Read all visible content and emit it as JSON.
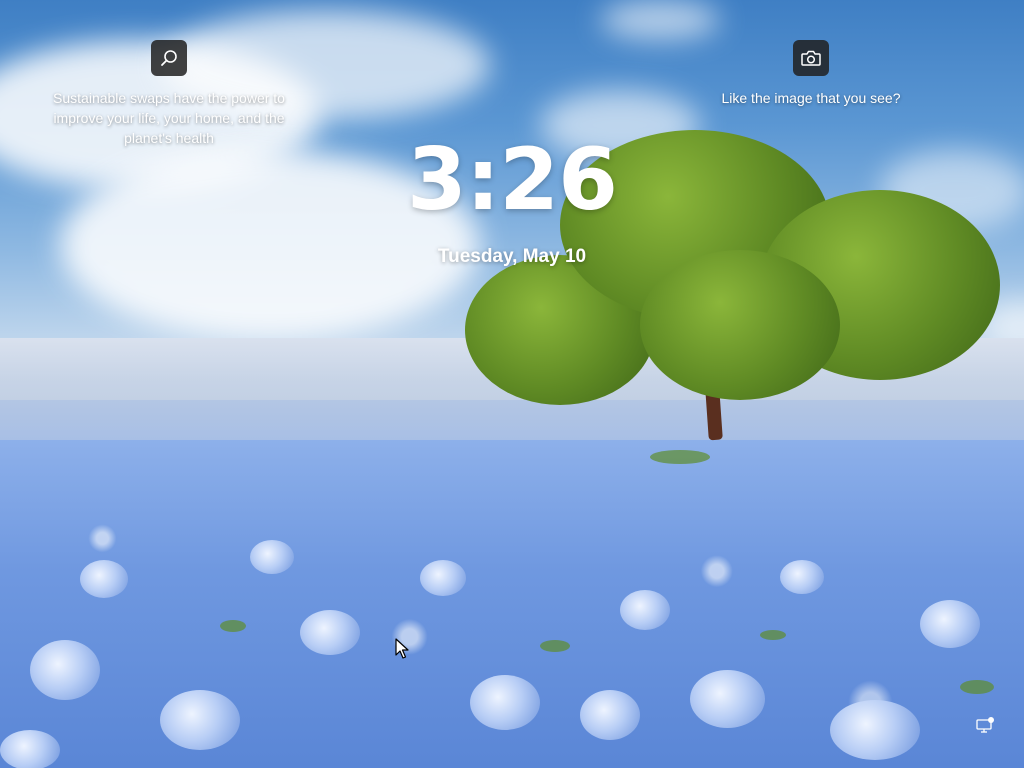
{
  "lock_screen": {
    "time": "3:26",
    "date": "Tuesday, May 10"
  },
  "spotlight": {
    "search_feature": {
      "icon": "search-icon",
      "text": "Sustainable swaps have the power to improve your life, your home, and the planet's health"
    },
    "camera_feature": {
      "icon": "camera-icon",
      "text": "Like the image that you see?"
    }
  },
  "status": {
    "network_icon": "network-status-icon"
  },
  "colors": {
    "text": "#ffffff",
    "tile_background": "#202020",
    "sky": "#5b97d3",
    "flowers": "#8db0ea",
    "foliage": "#5f8a24"
  }
}
